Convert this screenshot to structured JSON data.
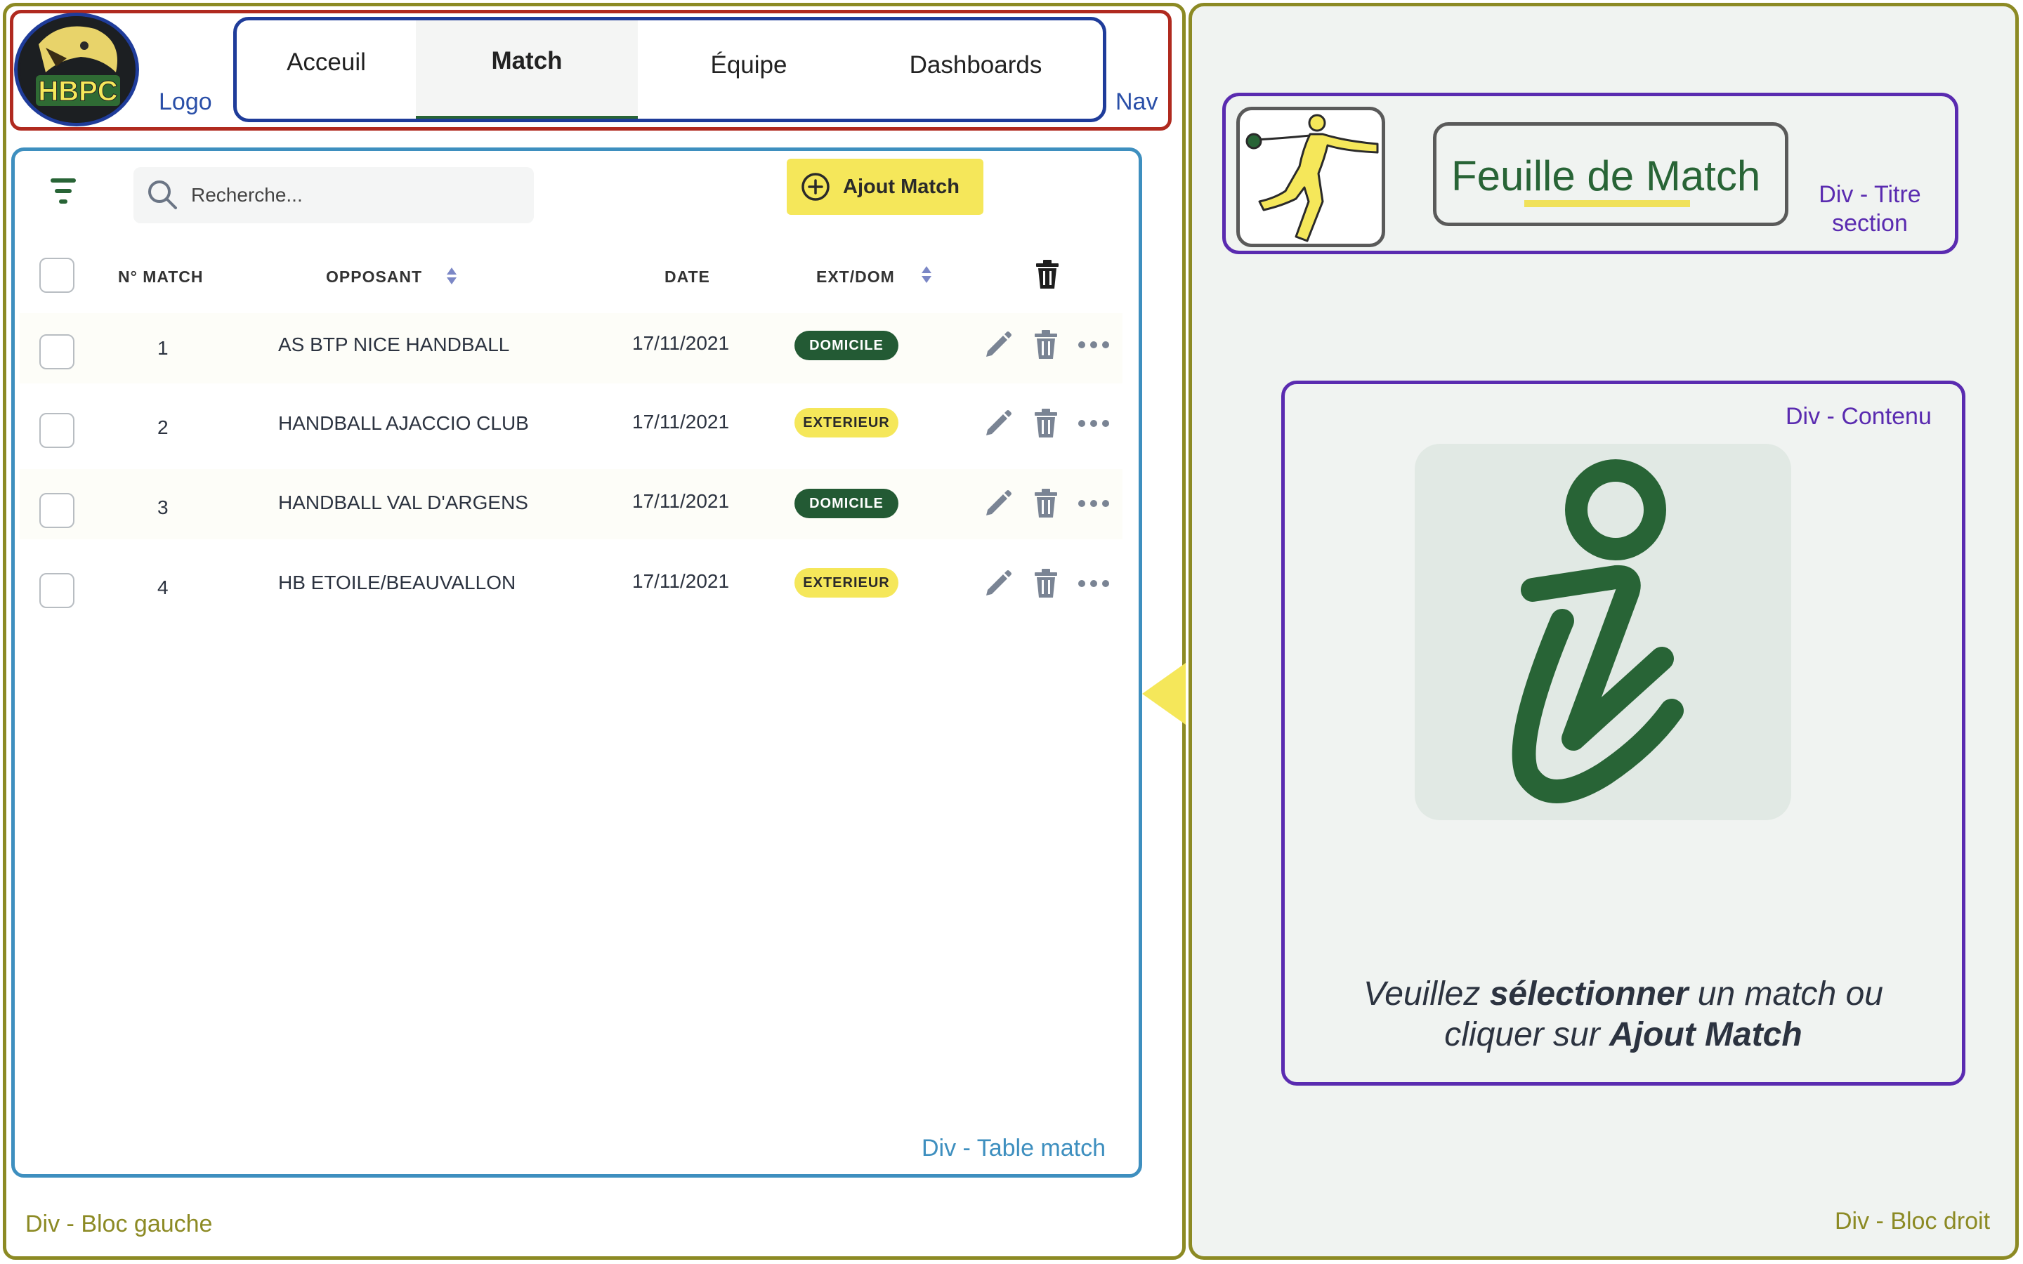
{
  "annotations": {
    "logo": "Logo",
    "nav": "Nav",
    "table": "Div - Table match",
    "bloc_gauche": "Div - Bloc gauche",
    "bloc_droit": "Div - Bloc droit",
    "titre_line1": "Div - Titre",
    "titre_line2": "section",
    "contenu": "Div - Contenu"
  },
  "logo": {
    "text": "HBPC"
  },
  "nav": {
    "tabs": [
      {
        "label": "Acceuil",
        "active": false
      },
      {
        "label": "Match",
        "active": true
      },
      {
        "label": "Équipe",
        "active": false
      },
      {
        "label": "Dashboards",
        "active": false
      }
    ]
  },
  "toolbar": {
    "search_placeholder": "Recherche...",
    "add_label": "Ajout Match"
  },
  "table": {
    "headers": {
      "num": "N° MATCH",
      "opponent": "OPPOSANT",
      "date": "DATE",
      "extdom": "EXT/DOM"
    },
    "rows": [
      {
        "num": "1",
        "opponent": "AS BTP NICE HANDBALL",
        "date": "17/11/2021",
        "status": "DOMICILE"
      },
      {
        "num": "2",
        "opponent": "HANDBALL AJACCIO CLUB",
        "date": "17/11/2021",
        "status": "EXTERIEUR"
      },
      {
        "num": "3",
        "opponent": "HANDBALL VAL D'ARGENS",
        "date": "17/11/2021",
        "status": "DOMICILE"
      },
      {
        "num": "4",
        "opponent": "HB ETOILE/BEAUVALLON",
        "date": "17/11/2021",
        "status": "EXTERIEUR"
      }
    ]
  },
  "right": {
    "title": "Feuille de Match",
    "msg1_pre": "Veuillez ",
    "msg1_bold": "sélectionner",
    "msg1_post": " un match ou",
    "msg2_pre": "cliquer sur ",
    "msg2_bold": "Ajout Match"
  },
  "colors": {
    "green": "#286436",
    "yellow": "#f5e75a",
    "annotation_blue": "#2a4fa8",
    "annotation_purple": "#5a2bb0",
    "annotation_olive": "#8c8a24",
    "annotation_cyan": "#3e8fbf"
  },
  "icons": [
    "filter-icon",
    "search-icon",
    "plus-circle-icon",
    "sort-icon",
    "trash-icon",
    "pencil-icon",
    "more-icon",
    "handball-player-icon",
    "info-icon"
  ]
}
